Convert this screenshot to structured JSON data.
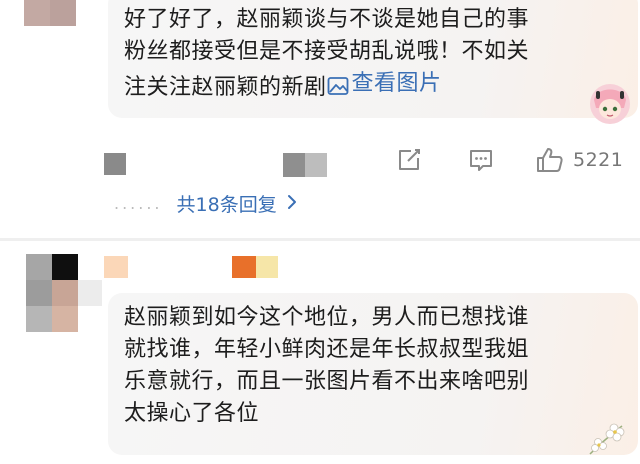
{
  "comment1": {
    "text_lines": [
      "好了好了，赵丽颖谈与不谈是她自己的事",
      "粉丝都接受但是不接受胡乱说哦！不如关",
      "注关注赵丽颖的新剧"
    ],
    "view_image_label": "查看图片",
    "like_count": "5221",
    "replies_label": "共18条回复",
    "replies_dots": "......"
  },
  "comment2": {
    "text_lines": [
      "赵丽颖到如今这个地位，男人而已想找谁",
      "就找谁，年轻小鲜肉还是年长叔叔型我姐",
      "乐意就行，而且一张图片看不出来啥吧别",
      "太操心了各位"
    ]
  },
  "icons": {
    "image": "image-icon",
    "share": "share-icon",
    "comment": "comment-icon",
    "like": "thumbs-up-icon",
    "chevron": "chevron-right-icon"
  },
  "colors": {
    "link": "#3a6fb5",
    "text": "#1d1d1d",
    "meta": "#888888"
  }
}
